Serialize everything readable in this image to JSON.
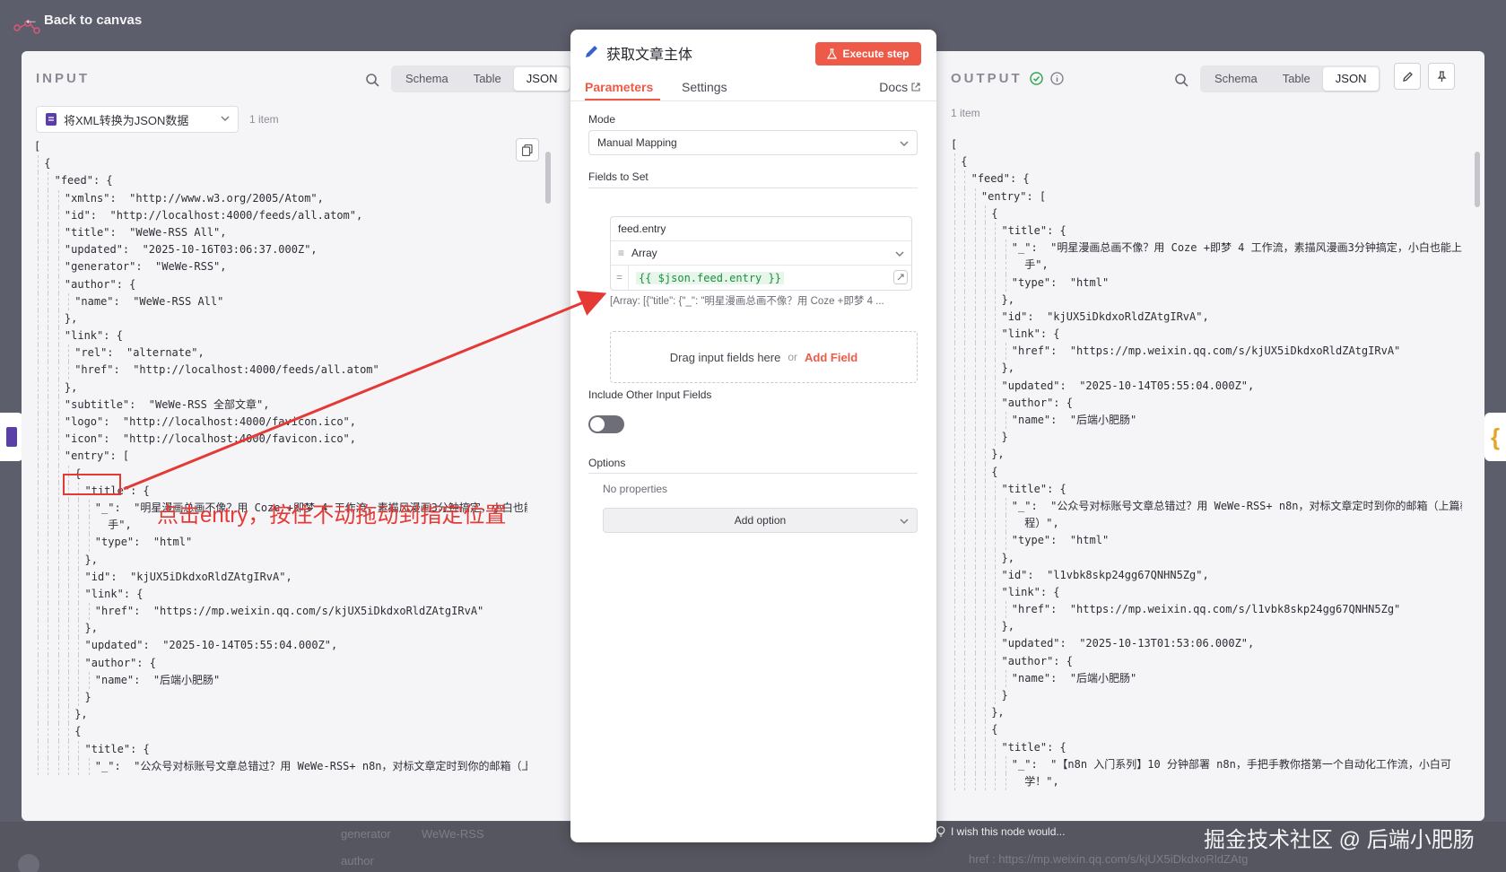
{
  "topbar": {
    "back_label": "Back to canvas"
  },
  "input": {
    "title": "INPUT",
    "tabs": [
      "Schema",
      "Table",
      "JSON"
    ],
    "active_tab": "JSON",
    "node_name": "将XML转换为JSON数据",
    "item_count": "1 item",
    "json_lines": [
      {
        "i": 0,
        "t": "["
      },
      {
        "i": 1,
        "t": "{"
      },
      {
        "i": 2,
        "t": "\"feed\": {"
      },
      {
        "i": 3,
        "t": "\"xmlns\":  \"http://www.w3.org/2005/Atom\","
      },
      {
        "i": 3,
        "t": "\"id\":  \"http://localhost:4000/feeds/all.atom\","
      },
      {
        "i": 3,
        "t": "\"title\":  \"WeWe-RSS All\","
      },
      {
        "i": 3,
        "t": "\"updated\":  \"2025-10-16T03:06:37.000Z\","
      },
      {
        "i": 3,
        "t": "\"generator\":  \"WeWe-RSS\","
      },
      {
        "i": 3,
        "t": "\"author\": {"
      },
      {
        "i": 4,
        "t": "\"name\":  \"WeWe-RSS All\""
      },
      {
        "i": 3,
        "t": "},"
      },
      {
        "i": 3,
        "t": "\"link\": {"
      },
      {
        "i": 4,
        "t": "\"rel\":  \"alternate\","
      },
      {
        "i": 4,
        "t": "\"href\":  \"http://localhost:4000/feeds/all.atom\""
      },
      {
        "i": 3,
        "t": "},"
      },
      {
        "i": 3,
        "t": "\"subtitle\":  \"WeWe-RSS 全部文章\","
      },
      {
        "i": 3,
        "t": "\"logo\":  \"http://localhost:4000/favicon.ico\","
      },
      {
        "i": 3,
        "t": "\"icon\":  \"http://localhost:4000/favicon.ico\","
      },
      {
        "i": 3,
        "t": "\"entry\": ["
      },
      {
        "i": 4,
        "t": "{"
      },
      {
        "i": 5,
        "t": "\"title\": {"
      },
      {
        "i": 6,
        "t": "\"_\":  \"明星漫画总画不像？用 Coze +即梦 4 工作流，素描风漫画3分钟搞定，小白也能上"
      },
      {
        "i": 6,
        "t": "  手\","
      },
      {
        "i": 6,
        "t": "\"type\":  \"html\""
      },
      {
        "i": 5,
        "t": "},"
      },
      {
        "i": 5,
        "t": "\"id\":  \"kjUX5iDkdxoRldZAtgIRvA\","
      },
      {
        "i": 5,
        "t": "\"link\": {"
      },
      {
        "i": 6,
        "t": "\"href\":  \"https://mp.weixin.qq.com/s/kjUX5iDkdxoRldZAtgIRvA\""
      },
      {
        "i": 5,
        "t": "},"
      },
      {
        "i": 5,
        "t": "\"updated\":  \"2025-10-14T05:55:04.000Z\","
      },
      {
        "i": 5,
        "t": "\"author\": {"
      },
      {
        "i": 6,
        "t": "\"name\":  \"后端小肥肠\""
      },
      {
        "i": 5,
        "t": "}"
      },
      {
        "i": 4,
        "t": "},"
      },
      {
        "i": 4,
        "t": "{"
      },
      {
        "i": 5,
        "t": "\"title\": {"
      },
      {
        "i": 6,
        "t": "\"_\":  \"公众号对标账号文章总错过？用 WeWe-RSS+ n8n，对标文章定时到你的邮箱（上篇教"
      }
    ]
  },
  "step": {
    "title": "获取文章主体",
    "execute_label": "Execute step",
    "tabs": {
      "parameters": "Parameters",
      "settings": "Settings",
      "docs": "Docs"
    },
    "mode_label": "Mode",
    "mode_value": "Manual Mapping",
    "fields_label": "Fields to Set",
    "field_name": "feed.entry",
    "field_type": "Array",
    "field_expr": "{{ $json.feed.entry }}",
    "field_preview": "[Array: [{\"title\": {\"_\": \"明星漫画总画不像？用 Coze +即梦 4 ...",
    "drop_text": "Drag input fields here",
    "drop_or": "or",
    "add_field": "Add Field",
    "include_label": "Include Other Input Fields",
    "options_label": "Options",
    "no_props": "No properties",
    "add_option": "Add option"
  },
  "output": {
    "title": "OUTPUT",
    "tabs": [
      "Schema",
      "Table",
      "JSON"
    ],
    "active_tab": "JSON",
    "item_count": "1 item",
    "json_lines": [
      {
        "i": 0,
        "t": "["
      },
      {
        "i": 1,
        "t": "{"
      },
      {
        "i": 2,
        "t": "\"feed\": {"
      },
      {
        "i": 3,
        "t": "\"entry\": ["
      },
      {
        "i": 4,
        "t": "{"
      },
      {
        "i": 5,
        "t": "\"title\": {"
      },
      {
        "i": 6,
        "t": "\"_\":  \"明星漫画总画不像？用 Coze +即梦 4 工作流，素描风漫画3分钟搞定，小白也能上"
      },
      {
        "i": 6,
        "t": "  手\","
      },
      {
        "i": 6,
        "t": "\"type\":  \"html\""
      },
      {
        "i": 5,
        "t": "},"
      },
      {
        "i": 5,
        "t": "\"id\":  \"kjUX5iDkdxoRldZAtgIRvA\","
      },
      {
        "i": 5,
        "t": "\"link\": {"
      },
      {
        "i": 6,
        "t": "\"href\":  \"https://mp.weixin.qq.com/s/kjUX5iDkdxoRldZAtgIRvA\""
      },
      {
        "i": 5,
        "t": "},"
      },
      {
        "i": 5,
        "t": "\"updated\":  \"2025-10-14T05:55:04.000Z\","
      },
      {
        "i": 5,
        "t": "\"author\": {"
      },
      {
        "i": 6,
        "t": "\"name\":  \"后端小肥肠\""
      },
      {
        "i": 5,
        "t": "}"
      },
      {
        "i": 4,
        "t": "},"
      },
      {
        "i": 4,
        "t": "{"
      },
      {
        "i": 5,
        "t": "\"title\": {"
      },
      {
        "i": 6,
        "t": "\"_\":  \"公众号对标账号文章总错过？用 WeWe-RSS+ n8n，对标文章定时到你的邮箱（上篇教"
      },
      {
        "i": 6,
        "t": "  程）\","
      },
      {
        "i": 6,
        "t": "\"type\":  \"html\""
      },
      {
        "i": 5,
        "t": "},"
      },
      {
        "i": 5,
        "t": "\"id\":  \"l1vbk8skp24gg67QNHN5Zg\","
      },
      {
        "i": 5,
        "t": "\"link\": {"
      },
      {
        "i": 6,
        "t": "\"href\":  \"https://mp.weixin.qq.com/s/l1vbk8skp24gg67QNHN5Zg\""
      },
      {
        "i": 5,
        "t": "},"
      },
      {
        "i": 5,
        "t": "\"updated\":  \"2025-10-13T01:53:06.000Z\","
      },
      {
        "i": 5,
        "t": "\"author\": {"
      },
      {
        "i": 6,
        "t": "\"name\":  \"后端小肥肠\""
      },
      {
        "i": 5,
        "t": "}"
      },
      {
        "i": 4,
        "t": "},"
      },
      {
        "i": 4,
        "t": "{"
      },
      {
        "i": 5,
        "t": "\"title\": {"
      },
      {
        "i": 6,
        "t": "\"_\":  \"【n8n 入门系列】10 分钟部署 n8n，手把手教你搭第一个自动化工作流，小白可"
      },
      {
        "i": 6,
        "t": "  学！\","
      }
    ]
  },
  "annotation": {
    "text": "点击entry，按住不动拖动到指定位置",
    "highlight": "\"entry\": "
  },
  "background": {
    "generator_key": "generator",
    "generator_val": "WeWe-RSS",
    "author_key": "author",
    "href_text": "href : https://mp.weixin.qq.com/s/kjUX5iDkdxoRldZAtg"
  },
  "footer": {
    "wish": "I wish this node would...",
    "watermark": "掘金技术社区 @ 后端小肥肠"
  },
  "colors": {
    "accent": "#ee5a48",
    "annotation": "#e53935",
    "success": "#2fa84f"
  }
}
